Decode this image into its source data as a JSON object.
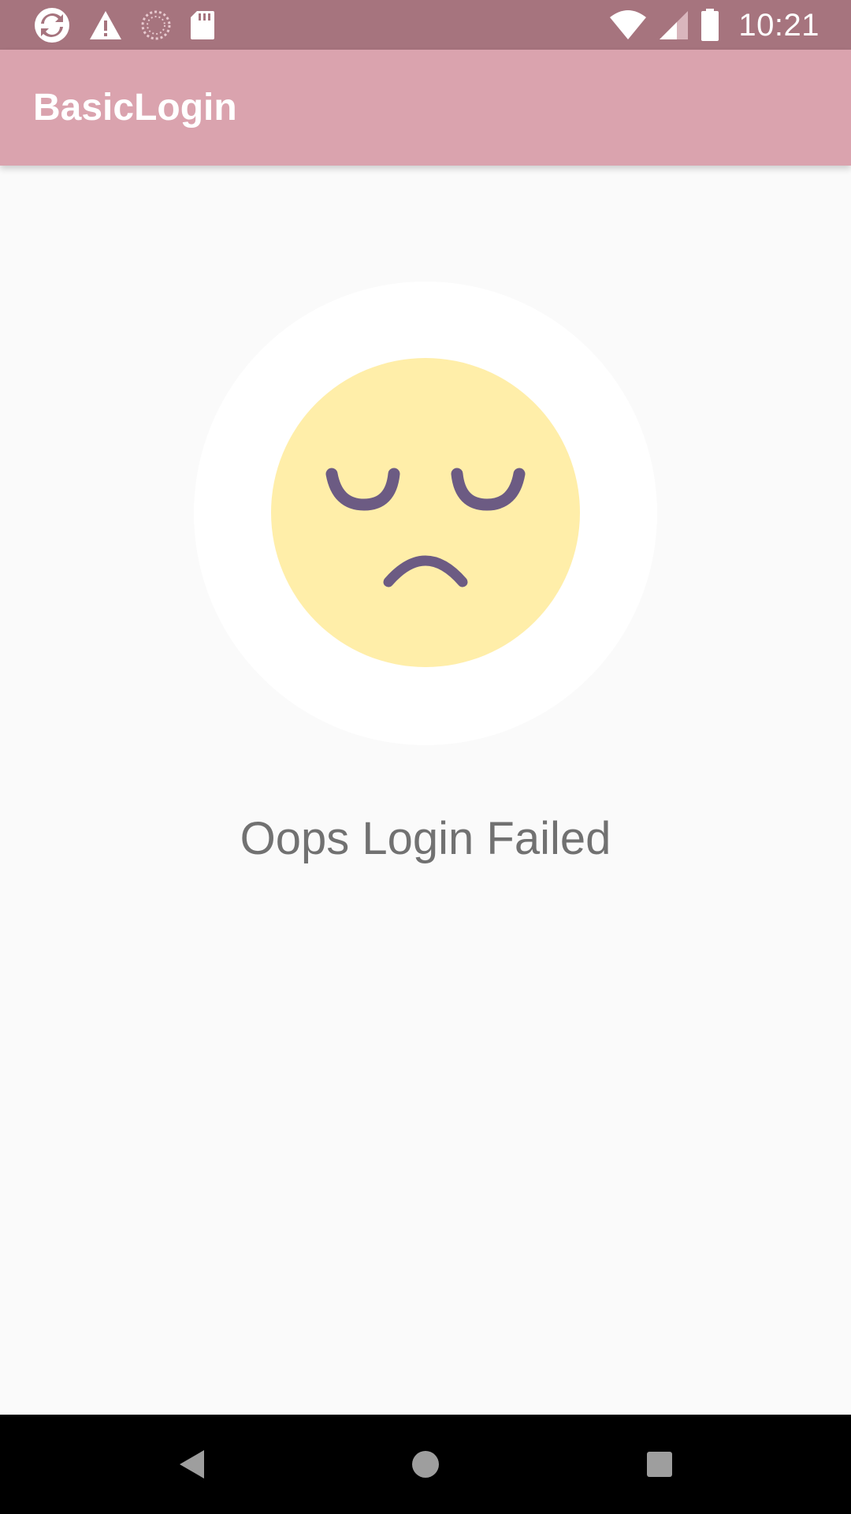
{
  "status_bar": {
    "time": "10:21",
    "left_icons": [
      "sync-icon",
      "warning-icon",
      "loading-circle-icon",
      "sd-card-icon"
    ],
    "right_icons": [
      "wifi-icon",
      "cell-signal-icon",
      "battery-icon"
    ]
  },
  "app_bar": {
    "title": "BasicLogin"
  },
  "main": {
    "illustration": "sad-face-icon",
    "message": "Oops Login Failed"
  },
  "nav_bar": {
    "buttons": [
      "back-icon",
      "home-icon",
      "recents-icon"
    ]
  },
  "colors": {
    "status_bar": "#a6747e",
    "app_bar": "#daa3ae",
    "background": "#fafafa",
    "face_fill": "#ffeea9",
    "face_features": "#6c5b83",
    "message_text": "#717171"
  }
}
